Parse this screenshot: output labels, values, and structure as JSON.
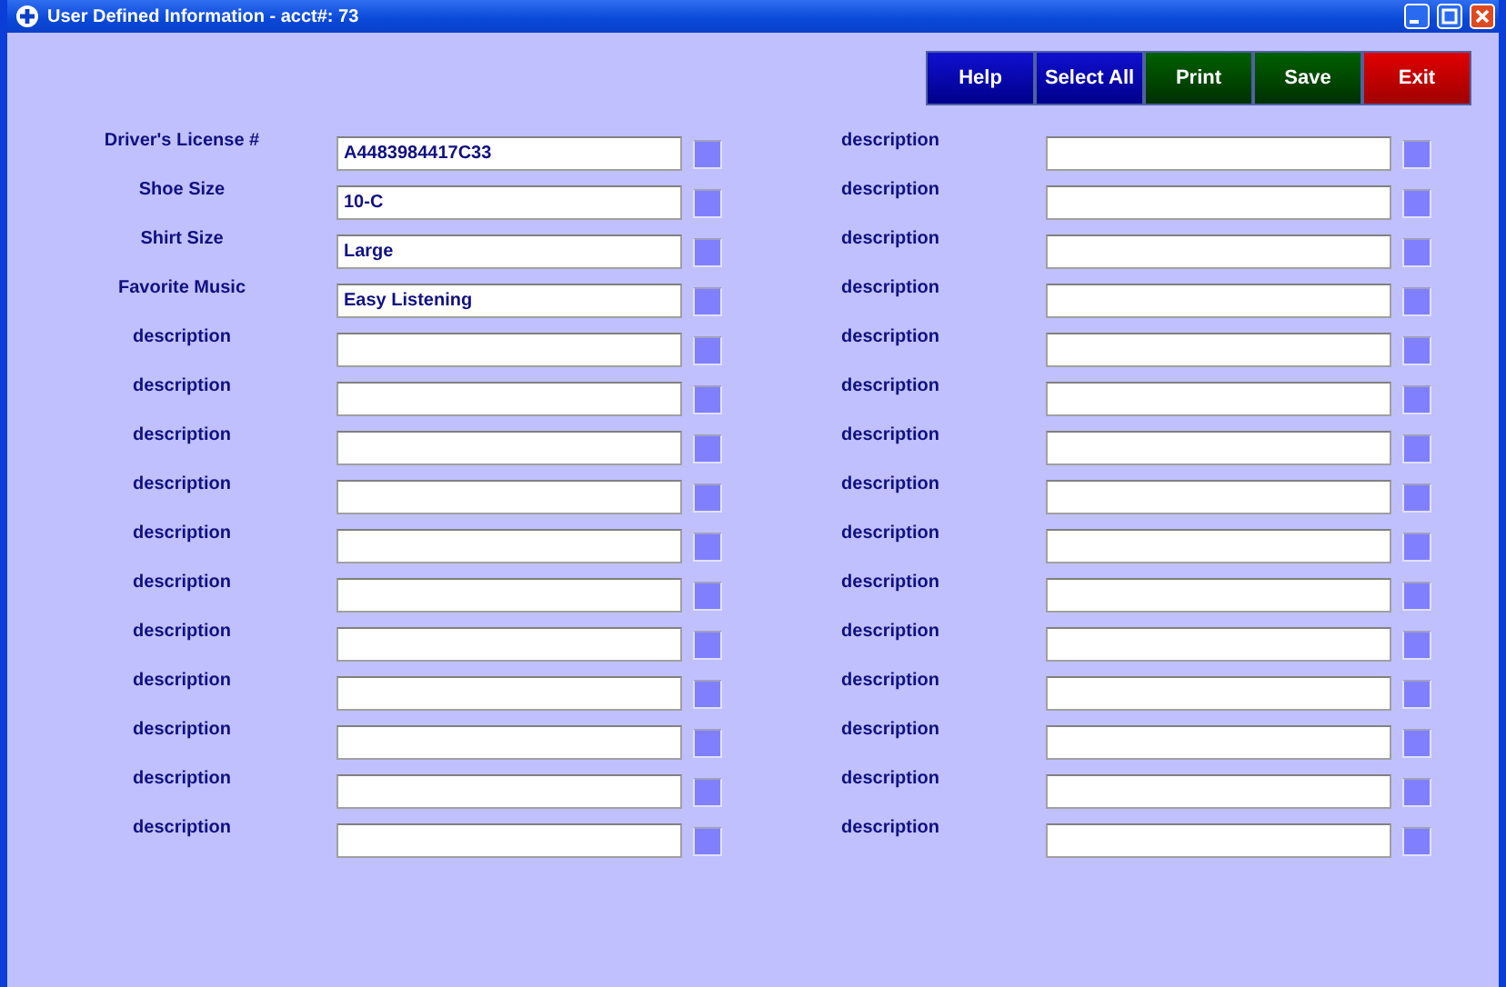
{
  "window": {
    "title": "User Defined Information - acct#: 73"
  },
  "buttons": [
    {
      "label": "Help",
      "kind": "blue"
    },
    {
      "label": "Select All",
      "kind": "blue"
    },
    {
      "label": "Print",
      "kind": "green"
    },
    {
      "label": "Save",
      "kind": "green"
    },
    {
      "label": "Exit",
      "kind": "red"
    }
  ],
  "left_fields": [
    {
      "label": "Driver's License #",
      "value": "A4483984417C33"
    },
    {
      "label": "Shoe Size",
      "value": "10-C"
    },
    {
      "label": "Shirt Size",
      "value": "Large"
    },
    {
      "label": "Favorite Music",
      "value": "Easy Listening"
    },
    {
      "label": "description"
    },
    {
      "label": "description"
    },
    {
      "label": "description"
    },
    {
      "label": "description"
    },
    {
      "label": "description"
    },
    {
      "label": "description"
    },
    {
      "label": "description"
    },
    {
      "label": "description"
    },
    {
      "label": "description"
    },
    {
      "label": "description"
    },
    {
      "label": "description"
    }
  ],
  "right_fields": [
    {
      "label": "description"
    },
    {
      "label": "description"
    },
    {
      "label": "description"
    },
    {
      "label": "description"
    },
    {
      "label": "description"
    },
    {
      "label": "description"
    },
    {
      "label": "description"
    },
    {
      "label": "description"
    },
    {
      "label": "description"
    },
    {
      "label": "description"
    },
    {
      "label": "description"
    },
    {
      "label": "description"
    },
    {
      "label": "description"
    },
    {
      "label": "description"
    },
    {
      "label": "description"
    }
  ]
}
